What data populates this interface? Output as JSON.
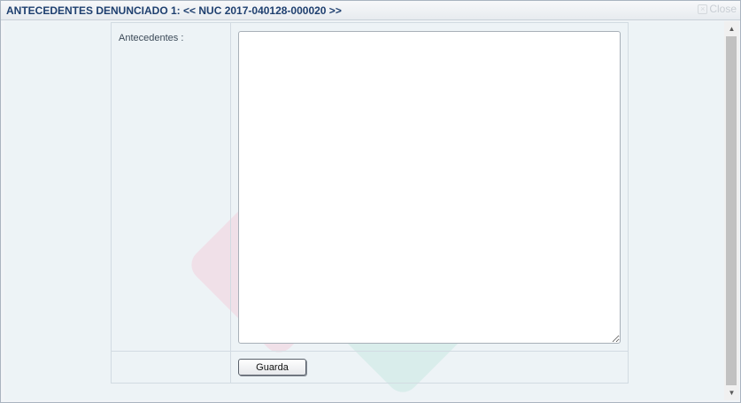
{
  "dialog": {
    "title": "ANTECEDENTES DENUNCIADO 1: << NUC 2017-040128-000020 >>",
    "close_label": "Close"
  },
  "form": {
    "antecedentes_label": "Antecedentes :",
    "antecedentes_value": "",
    "save_label": "Guarda"
  },
  "icons": {
    "close": "close-icon",
    "scroll_up": "arrow-up-icon",
    "scroll_down": "arrow-down-icon"
  },
  "colors": {
    "title_text": "#1e3f6f",
    "content_bg": "#edf3f6",
    "watermark_blue": "#cfe3ee",
    "watermark_pink": "#f1d7e3",
    "watermark_teal": "#cde8e6"
  }
}
